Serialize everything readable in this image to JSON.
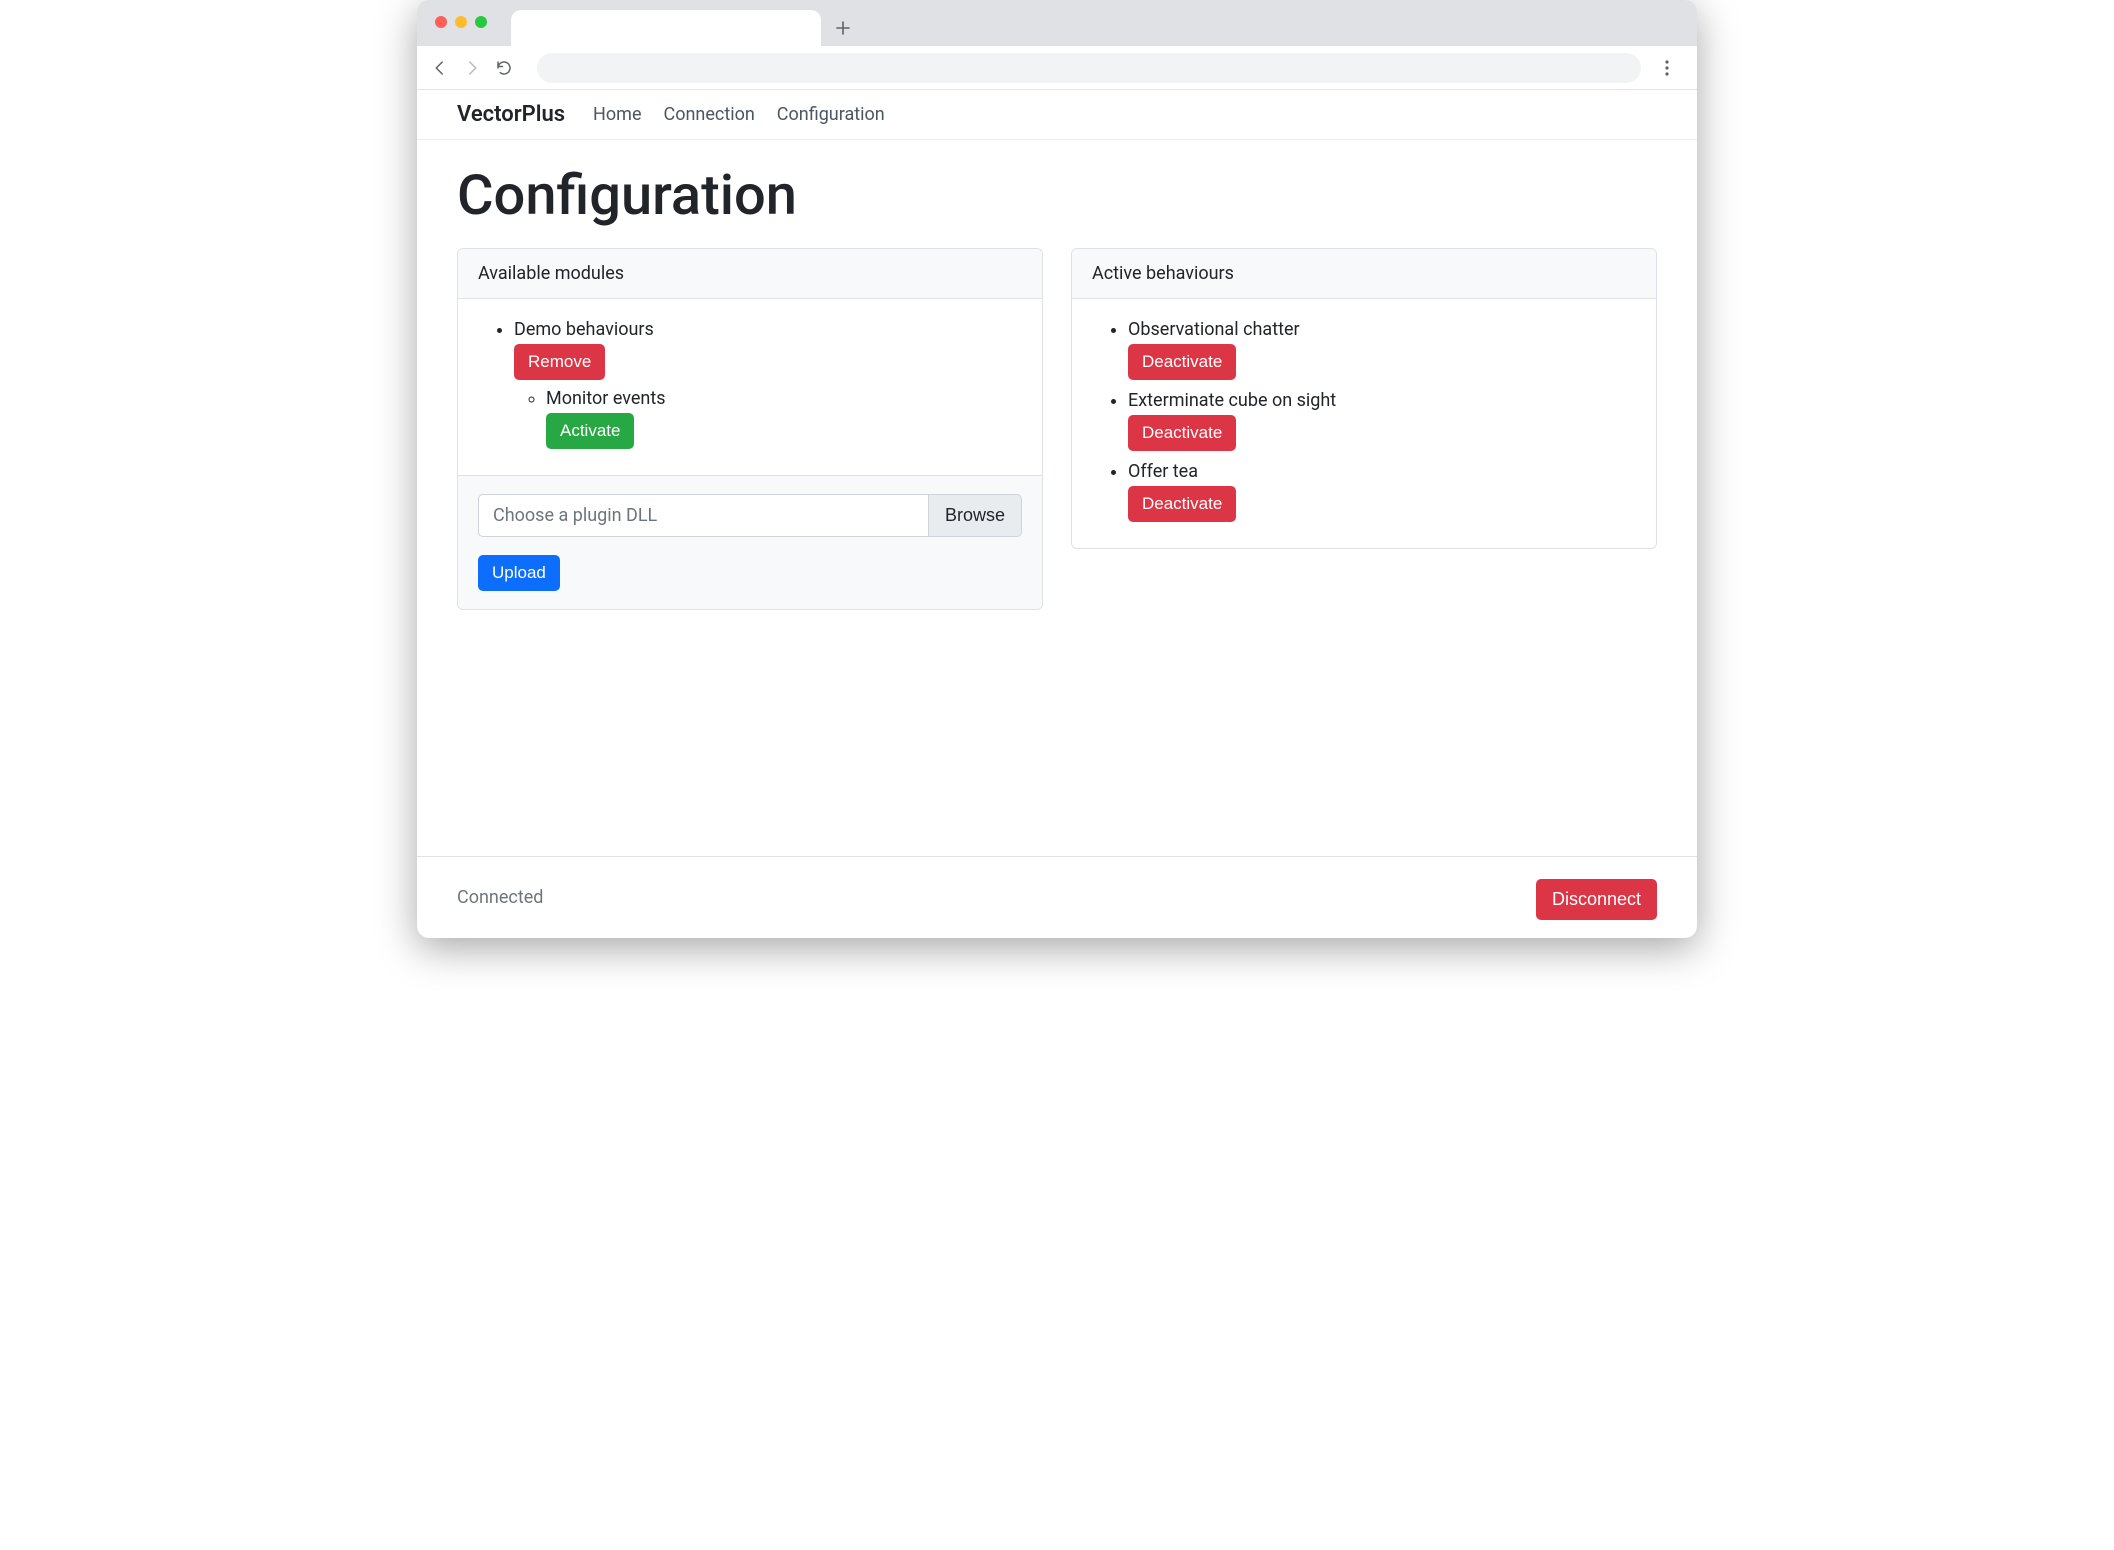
{
  "nav": {
    "brand": "VectorPlus",
    "links": [
      "Home",
      "Connection",
      "Configuration"
    ]
  },
  "page": {
    "title": "Configuration"
  },
  "modules": {
    "header": "Available modules",
    "items": [
      {
        "name": "Demo behaviours",
        "remove_label": "Remove",
        "children": [
          {
            "name": "Monitor events",
            "activate_label": "Activate"
          }
        ]
      }
    ],
    "upload": {
      "placeholder": "Choose a plugin DLL",
      "browse_label": "Browse",
      "upload_label": "Upload"
    }
  },
  "behaviours": {
    "header": "Active behaviours",
    "deactivate_label": "Deactivate",
    "items": [
      {
        "name": "Observational chatter"
      },
      {
        "name": "Exterminate cube on sight"
      },
      {
        "name": "Offer tea"
      }
    ]
  },
  "footer": {
    "status": "Connected",
    "disconnect_label": "Disconnect"
  }
}
